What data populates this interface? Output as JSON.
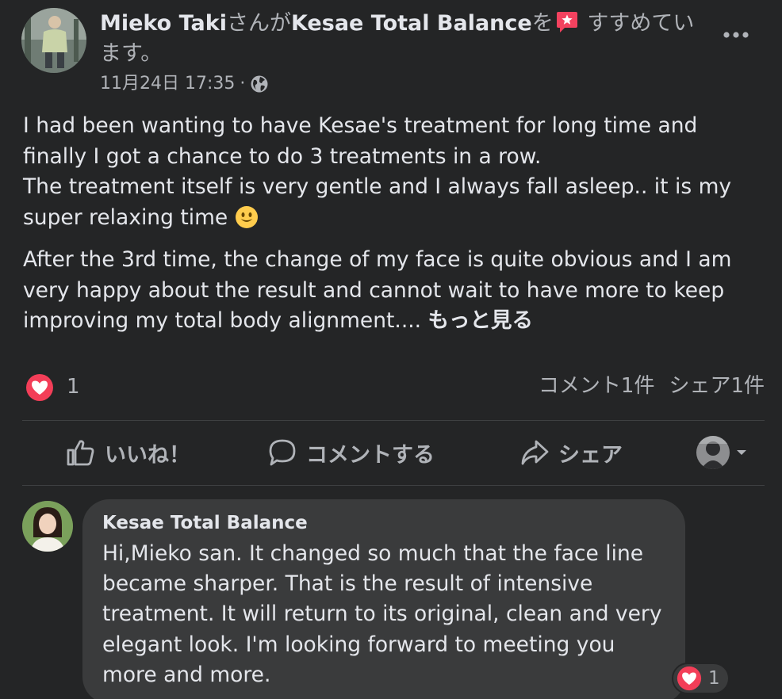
{
  "post": {
    "author": "Mieko Taki",
    "verb_1": "さんが",
    "page": "Kesae Total Balance",
    "verb_2": "を",
    "recommend": " すすめています。",
    "timestamp": "11月24日 17:35",
    "separator": " · ",
    "privacy_icon": "globe-icon",
    "paragraph_1": "I had been wanting to have Kesae's treatment for long time and finally I got a chance to do 3 treatments in a row.",
    "paragraph_2": "The treatment itself is very gentle and I always fall asleep.. it is my super relaxing time ",
    "paragraph_3": "After the 3rd time, the change of my face is quite obvious and I am very happy about the result and cannot wait to have more to keep improving my total body alignment.... ",
    "see_more": "もっと見る"
  },
  "stats": {
    "reaction_icon": "heart-icon",
    "reaction_count": "1",
    "comments": "コメント1件",
    "shares": "シェア1件"
  },
  "actions": {
    "like": "いいね！",
    "comment": "コメントする",
    "share": "シェア"
  },
  "comment": {
    "author": "Kesae Total Balance",
    "text": "Hi,Mieko san. It changed so much that the face line became sharper. That is the result of intensive treatment. It will return to its original, clean and very elegant look. I'm looking forward to meeting you more and more.",
    "reaction_count": "1"
  },
  "colors": {
    "background": "#242526",
    "bubble": "#3a3b3c",
    "text": "#e4e6eb",
    "muted": "#b0b3b8",
    "heart": "#f33e58"
  }
}
